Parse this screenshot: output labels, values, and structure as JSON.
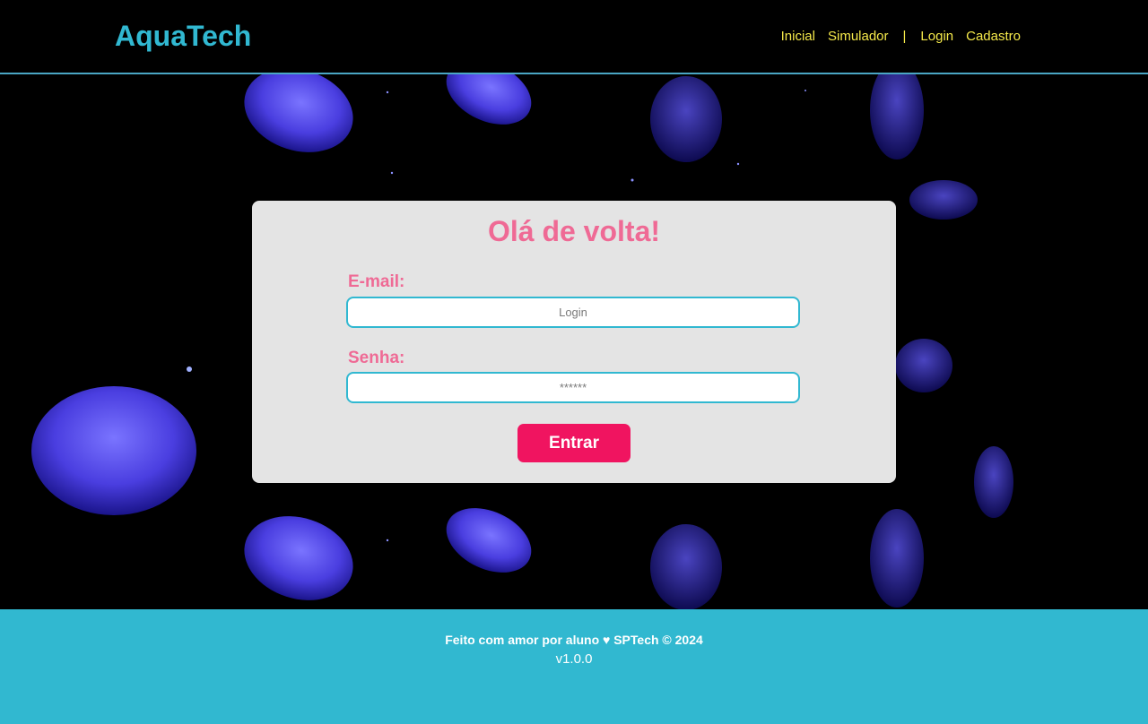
{
  "header": {
    "logo": "AquaTech",
    "nav": {
      "inicial": "Inicial",
      "simulador": "Simulador",
      "separator": "|",
      "login": "Login",
      "cadastro": "Cadastro"
    }
  },
  "login_card": {
    "title": "Olá de volta!",
    "email_label": "E-mail:",
    "email_placeholder": "Login",
    "email_value": "",
    "password_label": "Senha:",
    "password_placeholder": "******",
    "password_value": "",
    "submit_label": "Entrar"
  },
  "footer": {
    "credit": "Feito com amor por aluno ♥ SPTech © 2024",
    "version": "v1.0.0"
  },
  "colors": {
    "brand": "#31b8d1",
    "nav_link": "#f5e94a",
    "accent_pink": "#ef6a95",
    "button": "#f01460",
    "card_bg": "#e4e4e4",
    "footer_bg": "#31b8d0",
    "jellyfish": "#5a52f0"
  }
}
